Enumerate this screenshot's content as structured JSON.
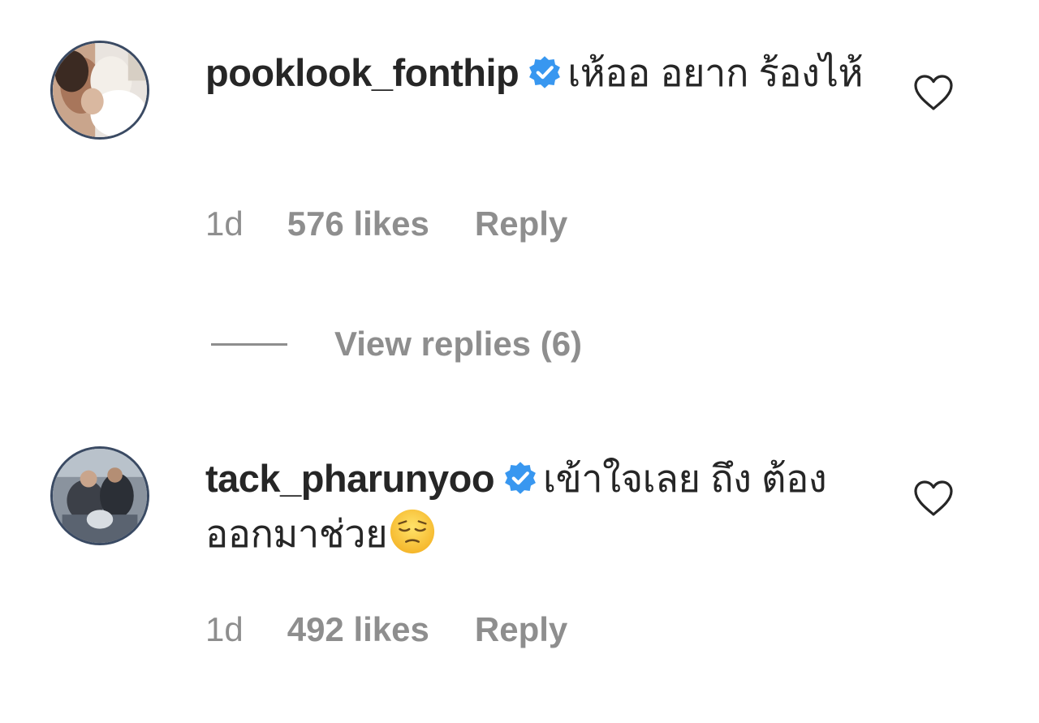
{
  "comments": [
    {
      "username": "pooklook_fonthip",
      "verified": true,
      "text": "เห้ออ อยาก ร้องไห้",
      "time": "1d",
      "likes": "576 likes",
      "reply_label": "Reply",
      "view_replies": "View replies (6)",
      "avatar_icon": "avatar-photo",
      "like_icon": "heart-outline-icon"
    },
    {
      "username": "tack_pharunyoo",
      "verified": true,
      "text": "เข้าใจเลย ถึง ต้องออกมาช่วย",
      "emoji": "pensive-face-emoji",
      "time": "1d",
      "likes": "492 likes",
      "reply_label": "Reply",
      "avatar_icon": "avatar-photo",
      "like_icon": "heart-outline-icon"
    }
  ],
  "colors": {
    "text_primary": "#262626",
    "text_secondary": "#8e8e8e",
    "verified_badge": "#3897f0",
    "background": "#ffffff"
  }
}
